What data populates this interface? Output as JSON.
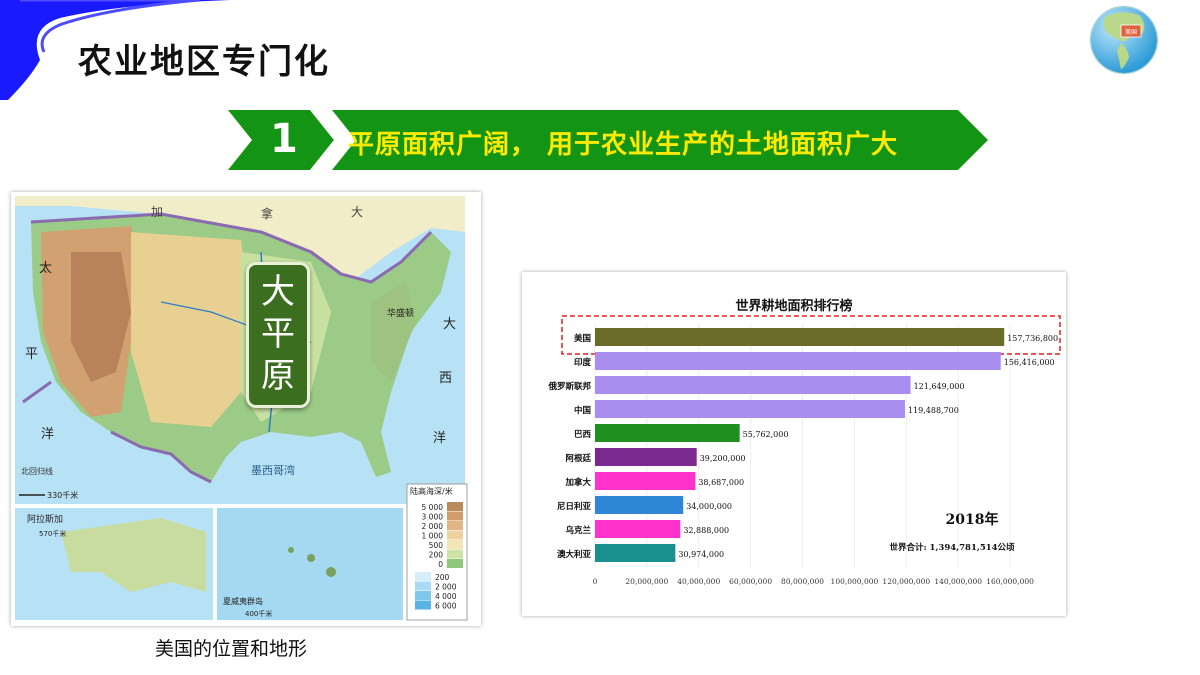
{
  "slide": {
    "title": "农业地区专门化",
    "banner_number": "1",
    "banner_text": "平原面积广阔， 用于农业生产的土地面积广大"
  },
  "globe": {
    "label": "美国"
  },
  "map": {
    "caption": "美国的位置和地形",
    "plain_label": [
      "大",
      "平",
      "原"
    ],
    "place_labels": {
      "alaska": "阿拉斯加",
      "hawaii": "夏威夷群岛",
      "pacific_1": "太",
      "pacific_2": "平",
      "pacific_3": "洋",
      "atlantic_1": "大",
      "atlantic_2": "西",
      "atlantic_3": "洋",
      "gulf": "墨西哥湾",
      "canada_1": "加",
      "canada_2": "拿",
      "canada_3": "大",
      "washington": "华盛顿",
      "north_pacific": "北回归线"
    },
    "scale_main": "330千米",
    "scale_alaska": "570千米",
    "scale_hawaii": "400千米",
    "legend": {
      "title": "陆高海深/米",
      "land": [
        "5 000",
        "3 000",
        "2 000",
        "1 000",
        "500",
        "200",
        "0"
      ],
      "sea": [
        "200",
        "2 000",
        "4 000",
        "6 000"
      ],
      "land_colors": [
        "#b98a5a",
        "#cf9e6b",
        "#e0b784",
        "#ecd29e",
        "#f2e6b4",
        "#cfe3a6",
        "#8fc77a"
      ],
      "sea_colors": [
        "#d5eef9",
        "#a9dcf3",
        "#7fc8ec",
        "#59b3e3"
      ]
    }
  },
  "chart_data": {
    "type": "bar",
    "title": "世界耕地面积排行榜",
    "categories": [
      "美国",
      "印度",
      "俄罗斯联邦",
      "中国",
      "巴西",
      "阿根廷",
      "加拿大",
      "尼日利亚",
      "乌克兰",
      "澳大利亚"
    ],
    "values": [
      157736800,
      156416000,
      121649000,
      119488700,
      55762000,
      39200000,
      38687000,
      34000000,
      32888000,
      30974000
    ],
    "value_labels": [
      "157,736,800",
      "156,416,000",
      "121,649,000",
      "119,488,700",
      "55,762,000",
      "39,200,000",
      "38,687,000",
      "34,000,000",
      "32,888,000",
      "30,974,000"
    ],
    "colors": [
      "#6b6b2a",
      "#a98ef0",
      "#a98ef0",
      "#a98ef0",
      "#1f8f1f",
      "#7a2a8f",
      "#ff33cc",
      "#2f86d6",
      "#ff33cc",
      "#1a8f8f"
    ],
    "xlim": [
      0,
      170000000
    ],
    "x_ticks": [
      0,
      20000000,
      40000000,
      60000000,
      80000000,
      100000000,
      120000000,
      140000000,
      160000000
    ],
    "x_tick_labels": [
      "0",
      "20,000,000",
      "40,000,000",
      "60,000,000",
      "80,000,000",
      "100,000,000",
      "120,000,000",
      "140,000,000",
      "160,000,000"
    ],
    "year_label": "2018年",
    "total_label": "世界合计: 1,394,781,514公顷",
    "highlight": "美国"
  }
}
